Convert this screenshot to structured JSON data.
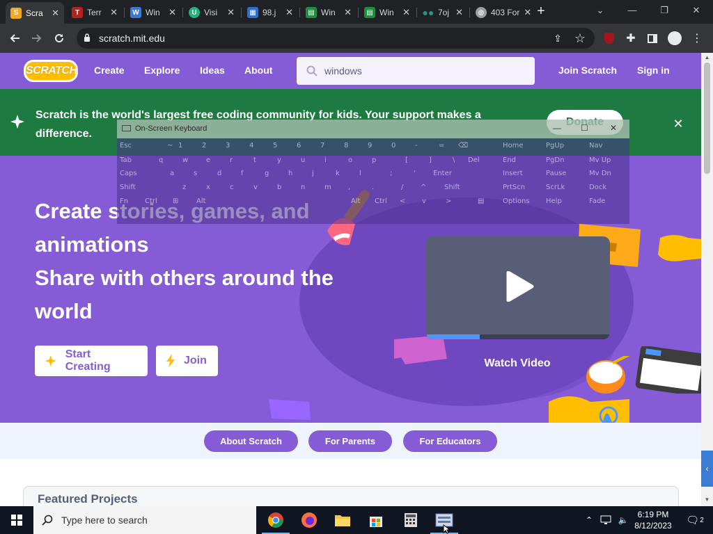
{
  "browser": {
    "tabs": [
      {
        "label": "Scra",
        "favicon": "scratch-icon",
        "color": "#f5a623",
        "active": true
      },
      {
        "label": "Terr",
        "favicon": "terrarium-icon",
        "color": "#b6221c"
      },
      {
        "label": "Win",
        "favicon": "windows-doc-icon",
        "color": "#3b78d8"
      },
      {
        "label": "Visi",
        "favicon": "u-icon",
        "color": "#1fb57a"
      },
      {
        "label": "98.j",
        "favicon": "image-icon",
        "color": "#2a6fc9"
      },
      {
        "label": "Win",
        "favicon": "sheets-icon",
        "color": "#1e8e3e"
      },
      {
        "label": "Win",
        "favicon": "sheets-icon",
        "color": "#1e8e3e"
      },
      {
        "label": "7oj",
        "favicon": "colab-icon",
        "color": "#2f8f8a"
      },
      {
        "label": "403 For",
        "favicon": "globe-icon",
        "color": "#9aa0a6"
      }
    ],
    "url": "scratch.mit.edu",
    "window_controls": {
      "minimize": "—",
      "restore": "❐",
      "close": "✕"
    }
  },
  "scratch": {
    "logo": "SCRATCH",
    "nav": [
      "Create",
      "Explore",
      "Ideas",
      "About"
    ],
    "search_value": "windows",
    "join": "Join Scratch",
    "signin": "Sign in",
    "banner_text": "Scratch is the world's largest free coding community for kids. Your support makes a difference.",
    "donate": "Donate",
    "hero_lines": [
      "Create stories, games, and",
      "animations",
      "Share with others around the",
      "world"
    ],
    "start_creating": "Start Creating",
    "join_button": "Join",
    "watch_video": "Watch Video",
    "video_progress": 0.29,
    "pills": [
      "About Scratch",
      "For Parents",
      "For Educators"
    ],
    "featured": "Featured Projects"
  },
  "osk": {
    "title": "On-Screen Keyboard",
    "row1": [
      "Esc",
      "~",
      "1",
      "2",
      "3",
      "4",
      "5",
      "6",
      "7",
      "8",
      "9",
      "0",
      "-",
      "=",
      "⌫"
    ],
    "row2": [
      "Tab",
      "q",
      "w",
      "e",
      "r",
      "t",
      "y",
      "u",
      "i",
      "o",
      "p",
      "[",
      "]",
      "\\",
      "Del"
    ],
    "row3": [
      "Caps",
      "a",
      "s",
      "d",
      "f",
      "g",
      "h",
      "j",
      "k",
      "l",
      ";",
      "'",
      "Enter"
    ],
    "row4": [
      "Shift",
      "z",
      "x",
      "c",
      "v",
      "b",
      "n",
      "m",
      ",",
      ".",
      "/",
      "^",
      "Shift"
    ],
    "row5": [
      "Fn",
      "Ctrl",
      "⊞",
      "Alt",
      "",
      "Alt",
      "Ctrl",
      "<",
      "v",
      ">",
      "▤"
    ],
    "nav_keys": [
      [
        "Home",
        "PgUp",
        "Nav"
      ],
      [
        "End",
        "PgDn",
        "Mv Up"
      ],
      [
        "Insert",
        "Pause",
        "Mv Dn"
      ],
      [
        "PrtScn",
        "ScrLk",
        "Dock"
      ],
      [
        "Options",
        "Help",
        "Fade"
      ]
    ]
  },
  "taskbar": {
    "search_placeholder": "Type here to search",
    "time": "6:19 PM",
    "date": "8/12/2023",
    "notifications": "2"
  }
}
